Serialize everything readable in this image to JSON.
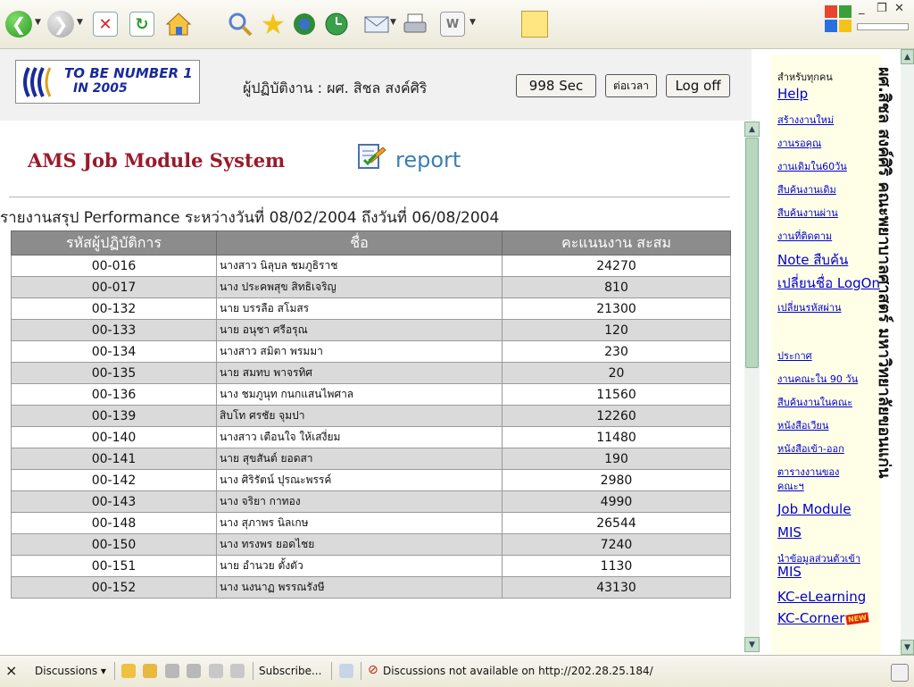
{
  "toolbar": {
    "icons": [
      "back-icon",
      "forward-icon",
      "stop-icon",
      "refresh-icon",
      "home-icon",
      "search-icon",
      "favorites-icon",
      "media-icon",
      "history-icon",
      "mail-icon",
      "print-icon",
      "edit-icon",
      "discuss-icon"
    ]
  },
  "header": {
    "logo_line1": "TO BE NUMBER 1",
    "logo_line2": "IN 2005",
    "operator": "ผู้ปฏิบัติงาน : ผศ. สิชล สงค์ศิริ",
    "timer": "998 Sec",
    "extend": "ต่อเวลา",
    "logoff": "Log off"
  },
  "page": {
    "system_title": "AMS Job Module System",
    "report_label": "report",
    "summary": "รายงานสรุป Performance ระหว่างวันที่ 08/02/2004 ถึงวันที่ 06/08/2004"
  },
  "table": {
    "columns": [
      "รหัสผู้ปฏิบัติการ",
      "ชื่อ",
      "คะแนนงาน สะสม"
    ],
    "rows": [
      {
        "id": "00-016",
        "name": "นางสาว นิลุบล ชมภูธิราช",
        "score": "24270"
      },
      {
        "id": "00-017",
        "name": "นาง ประคพสุข สิทธิเจริญ",
        "score": "810"
      },
      {
        "id": "00-132",
        "name": "นาย บรรลือ สโมสร",
        "score": "21300"
      },
      {
        "id": "00-133",
        "name": "นาย อนุชา ศรีอรุณ",
        "score": "120"
      },
      {
        "id": "00-134",
        "name": "นางสาว สมิตา พรมมา",
        "score": "230"
      },
      {
        "id": "00-135",
        "name": "นาย สมทบ พาจรทิศ",
        "score": "20"
      },
      {
        "id": "00-136",
        "name": "นาง ชมภูนุท กนกแสนไพศาล",
        "score": "11560"
      },
      {
        "id": "00-139",
        "name": "สิบโท ศรชัย จุมปา",
        "score": "12260"
      },
      {
        "id": "00-140",
        "name": "นางสาว เตือนใจ ให้เสงี่ยม",
        "score": "11480"
      },
      {
        "id": "00-141",
        "name": "นาย สุขสันต์ ยอดสา",
        "score": "190"
      },
      {
        "id": "00-142",
        "name": "นาง ศิริรัตน์ ปุรณะพรรค์",
        "score": "2980"
      },
      {
        "id": "00-143",
        "name": "นาง จริยา กาทอง",
        "score": "4990"
      },
      {
        "id": "00-148",
        "name": "นาง สุภาพร นิลเกษ",
        "score": "26544"
      },
      {
        "id": "00-150",
        "name": "นาง ทรงพร ยอดไชย",
        "score": "7240"
      },
      {
        "id": "00-151",
        "name": "นาย อำนวย ตั้งตัว",
        "score": "1130"
      },
      {
        "id": "00-152",
        "name": "นาง นงนาฏ พรรณรังษี",
        "score": "43130"
      }
    ]
  },
  "sidebar": {
    "for_all": "สำหรับทุกคน",
    "links": [
      {
        "label": "Help",
        "size": "b"
      },
      {
        "label": "สร้างงานใหม่",
        "size": "s"
      },
      {
        "label": "งานรอคุณ",
        "size": "s"
      },
      {
        "label": "งานเดิมใน60วัน",
        "size": "s"
      },
      {
        "label": "สืบค้นงานเดิม",
        "size": "s"
      },
      {
        "label": "สืบค้นงานผ่าน",
        "size": "s"
      },
      {
        "label": "งานที่ติดตาม",
        "size": "s"
      },
      {
        "label": "Note สืบค้น",
        "size": "b"
      },
      {
        "label": "เปลี่ยนชื่อ LogOn",
        "size": "b"
      },
      {
        "label": "เปลี่ยนรหัสผ่าน",
        "size": "s"
      },
      {
        "label": "ประกาศ",
        "size": "s"
      },
      {
        "label": "งานคณะใน 90 วัน",
        "size": "s"
      },
      {
        "label": "สืบค้นงานในคณะ",
        "size": "s"
      },
      {
        "label": "หนังสือเวียน",
        "size": "s"
      },
      {
        "label": "หนังสือเข้า-ออก",
        "size": "s"
      },
      {
        "label": "ตารางงานของ",
        "size": "s"
      },
      {
        "label": "คณะฯ",
        "size": "s"
      },
      {
        "label": "Job Module",
        "size": "b"
      },
      {
        "label": "MIS",
        "size": "b"
      },
      {
        "label": "นำข้อมูลส่วนตัวเข้า",
        "size": "s"
      },
      {
        "label": "MIS",
        "size": "b"
      },
      {
        "label": "KC-eLearning",
        "size": "b"
      },
      {
        "label": "KC-Corner",
        "size": "b"
      }
    ],
    "new_badge": "NEW",
    "vertical_text": "ผศ.สิชล สงค์ศิริ คณะพยาบาลศาสตร์ มหาวิทยาลัยขอนแก่น"
  },
  "discussion_bar": {
    "close": "×",
    "discussions": "Discussions ▾",
    "subscribe": "Subscribe...",
    "status": "Discussions not available on http://202.28.25.184/"
  },
  "colors": {
    "table_header": "#8c8c8c",
    "row_alt": "#dadada",
    "title_red": "#9a1a2a",
    "link_blue": "#0000cc",
    "sidebar_bg": "#ffffe8"
  }
}
